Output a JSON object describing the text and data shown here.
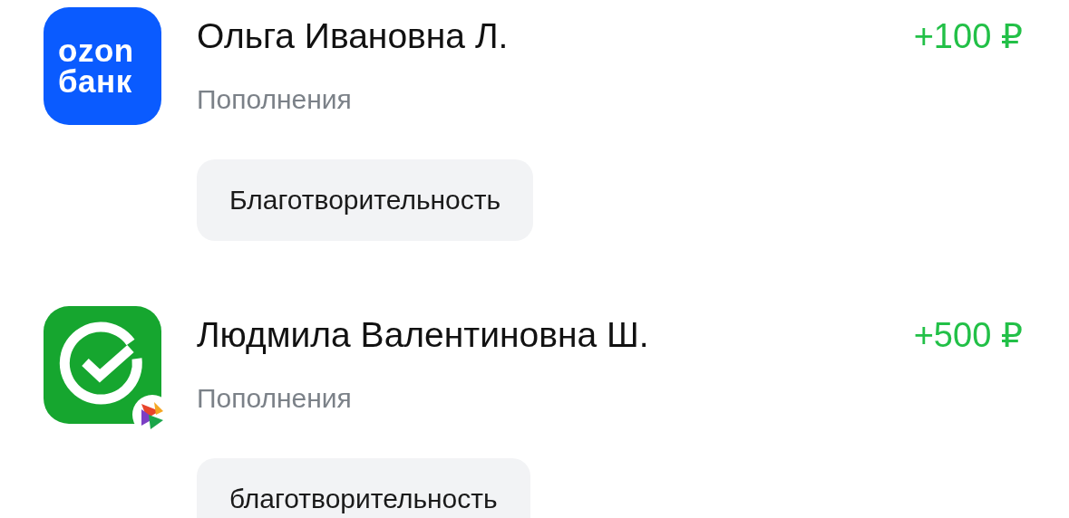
{
  "transactions": [
    {
      "icon": {
        "kind": "ozon",
        "lines": [
          "ozon",
          "банк"
        ]
      },
      "name": "Ольга Ивановна Л.",
      "amount": "+100 ₽",
      "category": "Пополнения",
      "tag": "Благотворительность"
    },
    {
      "icon": {
        "kind": "sber",
        "badge": true
      },
      "name": "Людмила Валентиновна Ш.",
      "amount": "+500 ₽",
      "category": "Пополнения",
      "tag": "благотворительность"
    }
  ]
}
